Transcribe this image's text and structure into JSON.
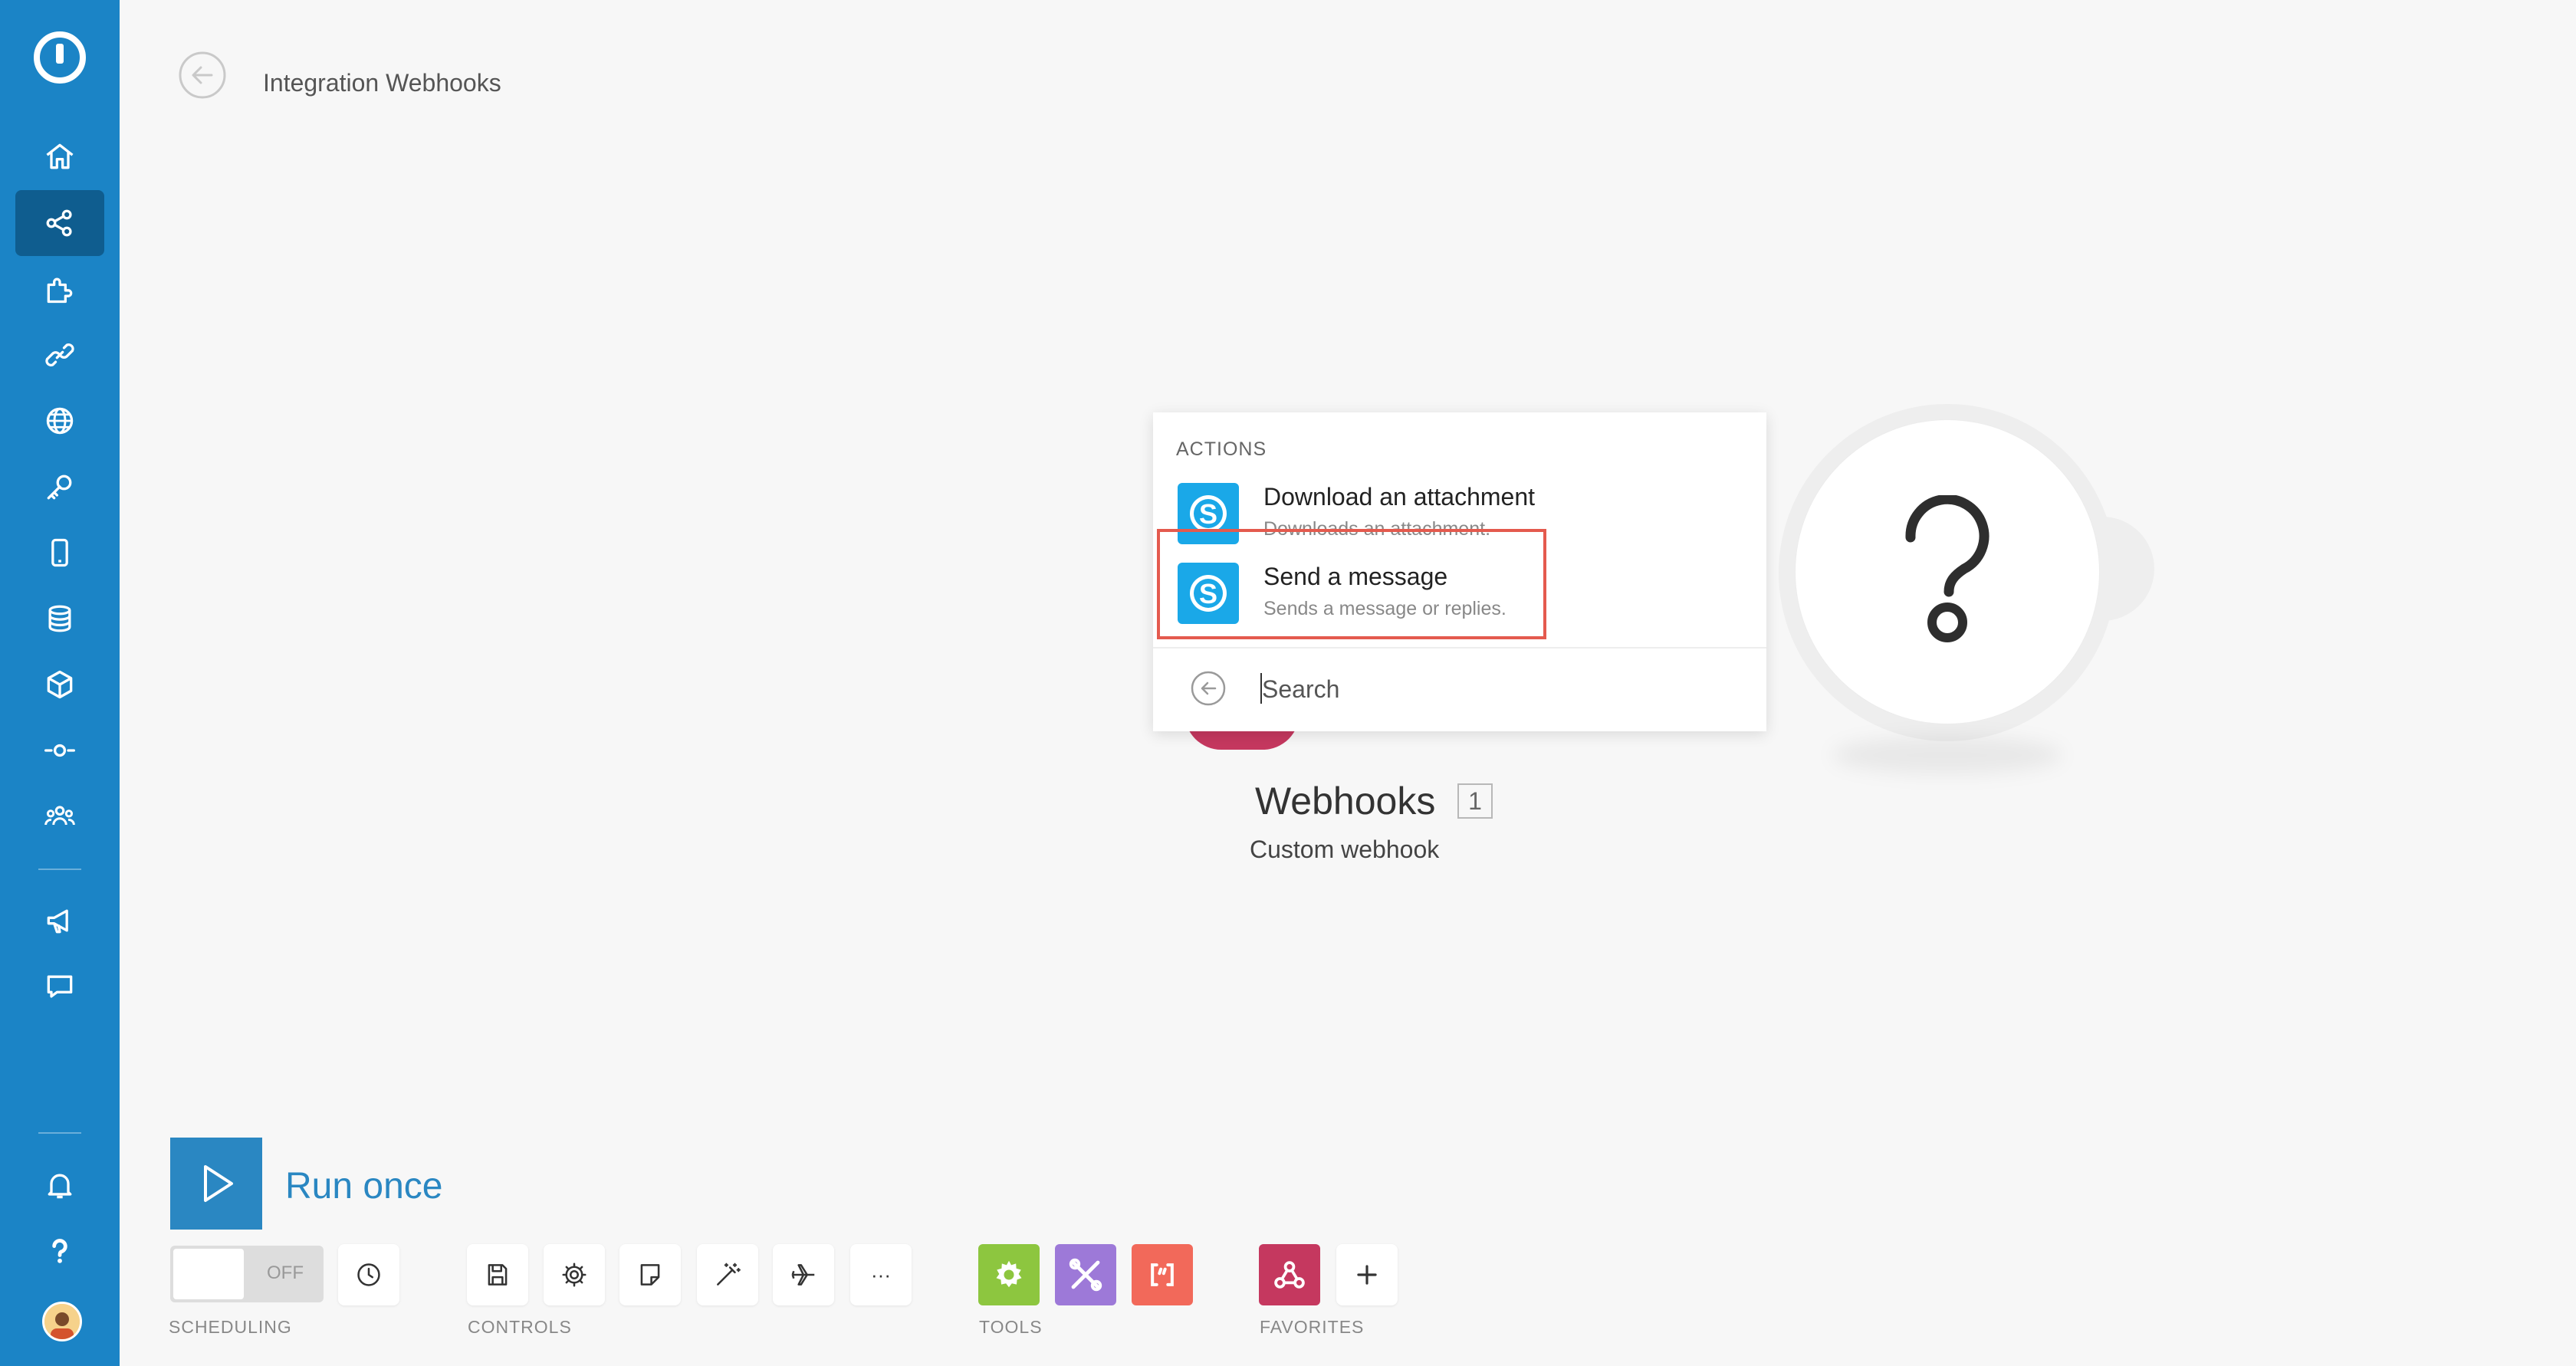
{
  "header": {
    "title": "Integration Webhooks"
  },
  "sidebar": {
    "items": [
      {
        "icon": "home-icon"
      },
      {
        "icon": "scenarios-icon",
        "active": true
      },
      {
        "icon": "puzzle-icon"
      },
      {
        "icon": "link-icon"
      },
      {
        "icon": "globe-icon"
      },
      {
        "icon": "key-icon"
      },
      {
        "icon": "mobile-device-icon"
      },
      {
        "icon": "database-icon"
      },
      {
        "icon": "cube-icon"
      },
      {
        "icon": "flow-icon"
      },
      {
        "icon": "team-icon"
      },
      {
        "icon": "megaphone-icon"
      },
      {
        "icon": "chat-icon"
      },
      {
        "icon": "bell-icon"
      },
      {
        "icon": "help-icon"
      }
    ]
  },
  "popup": {
    "heading": "ACTIONS",
    "actions": [
      {
        "title": "Download an attachment",
        "description": "Downloads an attachment."
      },
      {
        "title": "Send a message",
        "description": "Sends a message or replies."
      }
    ],
    "search_placeholder": "Search"
  },
  "module": {
    "name": "Webhooks",
    "badge": "1",
    "subtitle": "Custom webhook"
  },
  "hub": {
    "icon": "question-mark-icon"
  },
  "toolbar": {
    "run_label": "Run once",
    "toggle_label": "OFF",
    "sections": {
      "scheduling": "SCHEDULING",
      "controls": "CONTROLS",
      "tools": "TOOLS",
      "favorites": "FAVORITES"
    },
    "more_label": "···",
    "tools": [
      {
        "name": "tools-flow-control",
        "color": "#8dc63f"
      },
      {
        "name": "tools-operations",
        "color": "#9d79d8"
      },
      {
        "name": "tools-text-parser",
        "color": "#f2695a"
      }
    ],
    "favorites": [
      {
        "name": "webhooks",
        "color": "#c5385f"
      }
    ]
  },
  "colors": {
    "sidebar": "#1b84c6",
    "sidebar_active": "#0f5d8f",
    "accent": "#2a87c2",
    "skype": "#1aa8e8",
    "highlight": "#e45a4e"
  }
}
